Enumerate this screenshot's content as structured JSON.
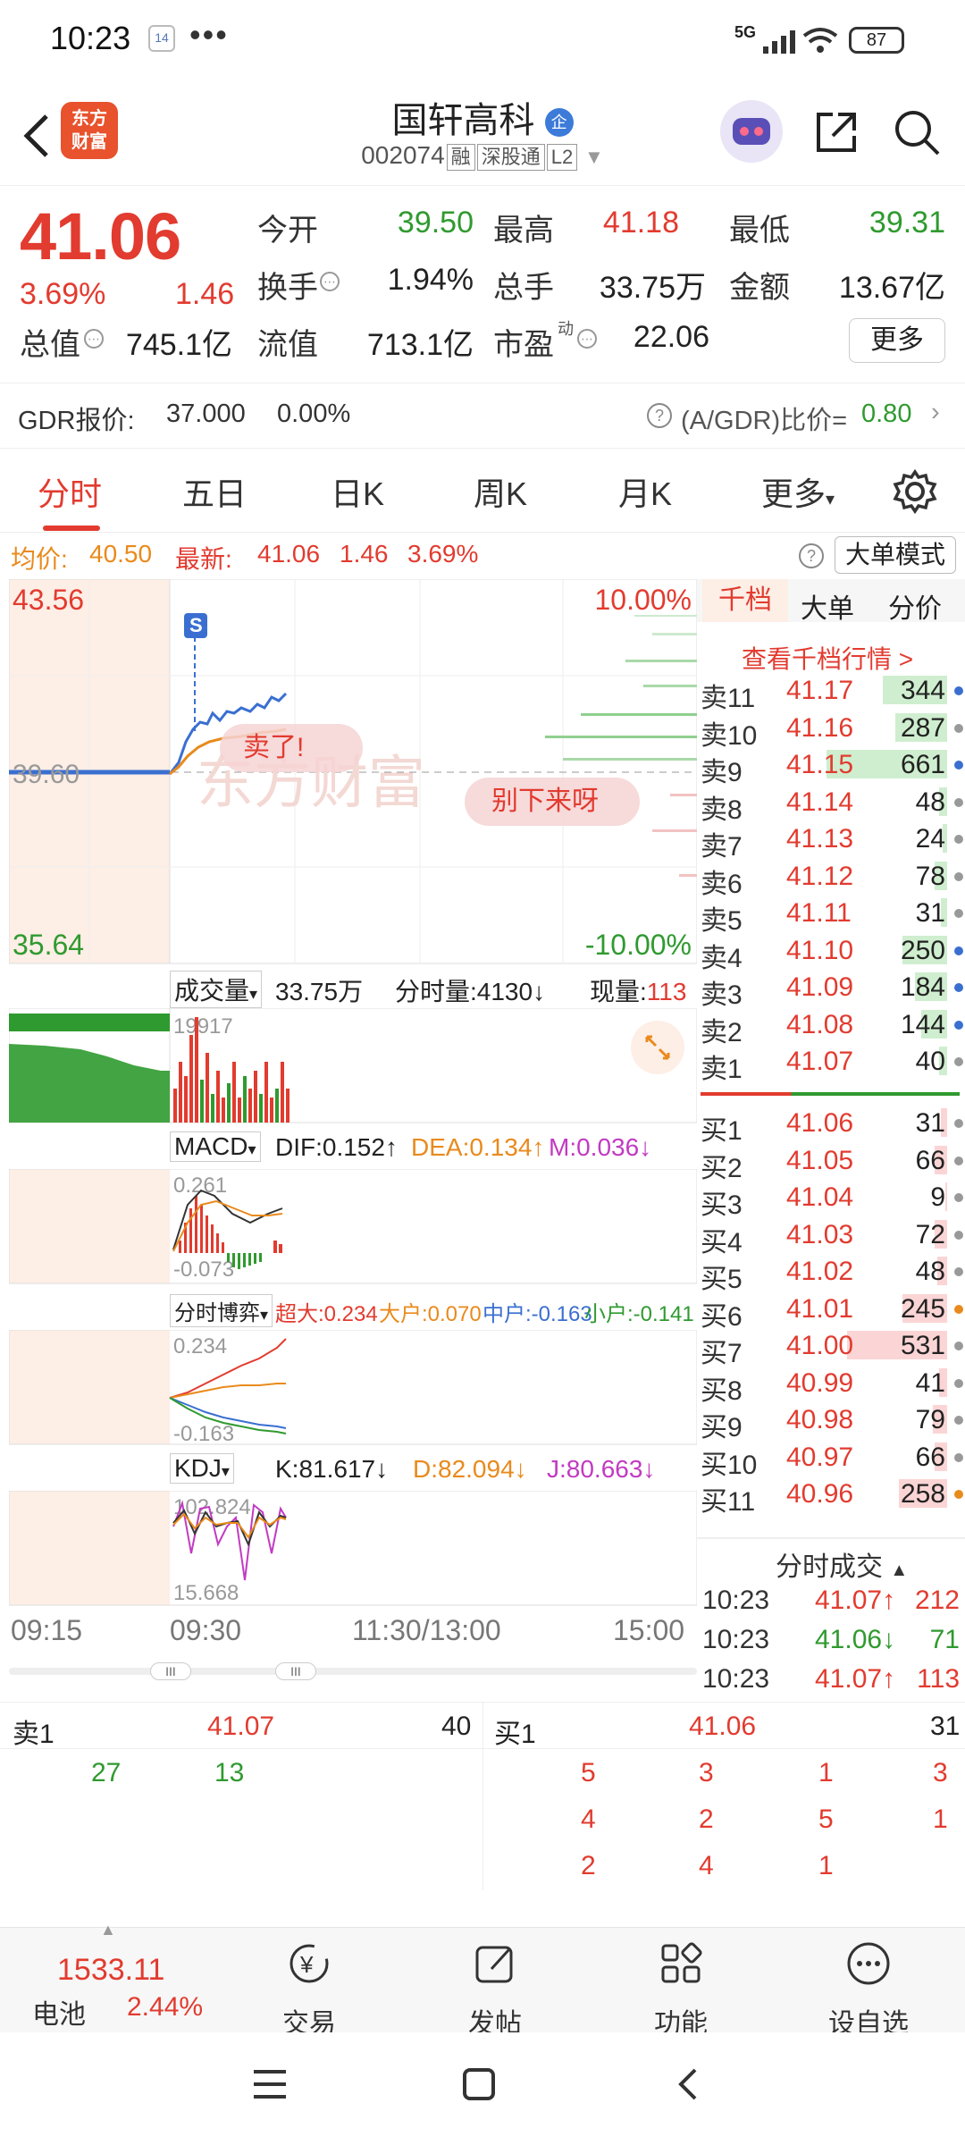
{
  "status": {
    "time": "10:23",
    "badge": "14",
    "network": "5G",
    "battery": "87"
  },
  "header": {
    "title": "国轩高科",
    "title_badge": "企",
    "logo_text": "东方\n财富",
    "code": "002074",
    "tags": [
      "融",
      "深股通",
      "L2"
    ]
  },
  "quote": {
    "price": "41.06",
    "pct": "3.69%",
    "chg": "1.46",
    "fields": [
      {
        "label": "今开",
        "value": "39.50",
        "color": "#2f9a2f"
      },
      {
        "label": "最高",
        "value": "41.18",
        "color": "#e23b2f"
      },
      {
        "label": "最低",
        "value": "39.31",
        "color": "#2f9a2f"
      },
      {
        "label": "换手",
        "value": "1.94%",
        "color": "#222"
      },
      {
        "label": "总手",
        "value": "33.75万",
        "color": "#222"
      },
      {
        "label": "金额",
        "value": "13.67亿",
        "color": "#222"
      },
      {
        "label": "总值",
        "value": "745.1亿",
        "color": "#222"
      },
      {
        "label": "流值",
        "value": "713.1亿",
        "color": "#222"
      },
      {
        "label": "市盈",
        "value": "22.06",
        "color": "#222"
      }
    ],
    "pe_superscript": "动",
    "more": "更多"
  },
  "gdr": {
    "label": "GDR报价:",
    "value": "37.000",
    "pct": "0.00%",
    "ratio_label": "(A/GDR)比价=",
    "ratio_value": "0.80"
  },
  "tabs": [
    "分时",
    "五日",
    "日K",
    "周K",
    "月K",
    "更多"
  ],
  "avg": {
    "avg_label": "均价:",
    "avg": "40.50",
    "last_label": "最新:",
    "last": "41.06",
    "chg": "1.46",
    "pct": "3.69%",
    "mode": "大单模式"
  },
  "chart": {
    "top_price": "43.56",
    "mid_price": "39.60",
    "bottom_price": "35.64",
    "top_pct": "10.00%",
    "bottom_pct": "-10.00%",
    "s_marker": "S",
    "bubble1": "卖了!",
    "bubble2": "别下来呀",
    "watermark": "东方财富",
    "vol_label": "成交量",
    "vol_value": "33.75万",
    "tick_vol": "分时量:4130↓",
    "now_vol": "现量:113",
    "vol_max": "19917",
    "macd_label": "MACD",
    "dif": "DIF:0.152↑",
    "dea": "DEA:0.134↑",
    "m": "M:0.036↓",
    "macd_top": "0.261",
    "macd_bot": "-0.073",
    "game_label": "分时博弈",
    "super": "超大:0.234",
    "big": "大户:0.070",
    "mid": "中户:-0.163",
    "small": "小户:-0.141",
    "game_top": "0.234",
    "game_bot": "-0.163",
    "kdj_label": "KDJ",
    "k": "K:81.617↓",
    "d": "D:82.094↓",
    "j": "J:80.663↓",
    "kdj_top": "102.824",
    "kdj_bot": "15.668",
    "times": [
      "09:15",
      "09:30",
      "11:30/13:00",
      "15:00"
    ],
    "slider_handle": "III"
  },
  "orderbook": {
    "tabs": [
      "千档",
      "大单",
      "分价"
    ],
    "view_more": "查看千档行情 >",
    "asks": [
      {
        "l": "卖11",
        "p": "41.17",
        "v": "344",
        "bar": 0.4,
        "dot": "#3a6fd1"
      },
      {
        "l": "卖10",
        "p": "41.16",
        "v": "287",
        "bar": 0.32,
        "dot": "#999"
      },
      {
        "l": "卖9",
        "p": "41.15",
        "v": "661",
        "bar": 0.75,
        "dot": "#3a6fd1"
      },
      {
        "l": "卖8",
        "p": "41.14",
        "v": "48",
        "bar": 0.05,
        "dot": "#999"
      },
      {
        "l": "卖7",
        "p": "41.13",
        "v": "24",
        "bar": 0.03,
        "dot": "#999"
      },
      {
        "l": "卖6",
        "p": "41.12",
        "v": "78",
        "bar": 0.08,
        "dot": "#999"
      },
      {
        "l": "卖5",
        "p": "41.11",
        "v": "31",
        "bar": 0.04,
        "dot": "#999"
      },
      {
        "l": "卖4",
        "p": "41.10",
        "v": "250",
        "bar": 0.28,
        "dot": "#3a6fd1"
      },
      {
        "l": "卖3",
        "p": "41.09",
        "v": "184",
        "bar": 0.2,
        "dot": "#3a6fd1"
      },
      {
        "l": "卖2",
        "p": "41.08",
        "v": "144",
        "bar": 0.16,
        "dot": "#3a6fd1"
      },
      {
        "l": "卖1",
        "p": "41.07",
        "v": "40",
        "bar": 0.05,
        "dot": "#999"
      }
    ],
    "bids": [
      {
        "l": "买1",
        "p": "41.06",
        "v": "31",
        "bar": 0.04,
        "dot": "#999"
      },
      {
        "l": "买2",
        "p": "41.05",
        "v": "66",
        "bar": 0.08,
        "dot": "#999"
      },
      {
        "l": "买3",
        "p": "41.04",
        "v": "9",
        "bar": 0.01,
        "dot": "#999"
      },
      {
        "l": "买4",
        "p": "41.03",
        "v": "72",
        "bar": 0.08,
        "dot": "#999"
      },
      {
        "l": "买5",
        "p": "41.02",
        "v": "48",
        "bar": 0.06,
        "dot": "#999"
      },
      {
        "l": "买6",
        "p": "41.01",
        "v": "245",
        "bar": 0.28,
        "dot": "#e98a1c"
      },
      {
        "l": "买7",
        "p": "41.00",
        "v": "531",
        "bar": 0.62,
        "dot": "#999"
      },
      {
        "l": "买8",
        "p": "40.99",
        "v": "41",
        "bar": 0.05,
        "dot": "#999"
      },
      {
        "l": "买9",
        "p": "40.98",
        "v": "79",
        "bar": 0.09,
        "dot": "#999"
      },
      {
        "l": "买10",
        "p": "40.97",
        "v": "66",
        "bar": 0.08,
        "dot": "#999"
      },
      {
        "l": "买11",
        "p": "40.96",
        "v": "258",
        "bar": 0.3,
        "dot": "#e98a1c"
      }
    ],
    "ticks_title": "分时成交",
    "ticks": [
      {
        "t": "10:23",
        "p": "41.07↑",
        "v": "212",
        "c": "#e23b2f"
      },
      {
        "t": "10:23",
        "p": "41.06↓",
        "v": "71",
        "c": "#2f9a2f"
      },
      {
        "t": "10:23",
        "p": "41.07↑",
        "v": "113",
        "c": "#e23b2f"
      }
    ]
  },
  "level2": {
    "ask_label": "卖1",
    "ask_price": "41.07",
    "ask_vol": "40",
    "bid_label": "买1",
    "bid_price": "41.06",
    "bid_vol": "31",
    "ask_queue": [
      "27",
      "13"
    ],
    "bid_queue": [
      [
        "5",
        "3",
        "1",
        "3"
      ],
      [
        "4",
        "2",
        "5",
        "1"
      ],
      [
        "2",
        "4",
        "1"
      ]
    ]
  },
  "toolbar": {
    "index_value": "1533.11",
    "index_name": "电池",
    "index_pct": "2.44%",
    "items": [
      "交易",
      "发帖",
      "功能",
      "设自选"
    ]
  }
}
